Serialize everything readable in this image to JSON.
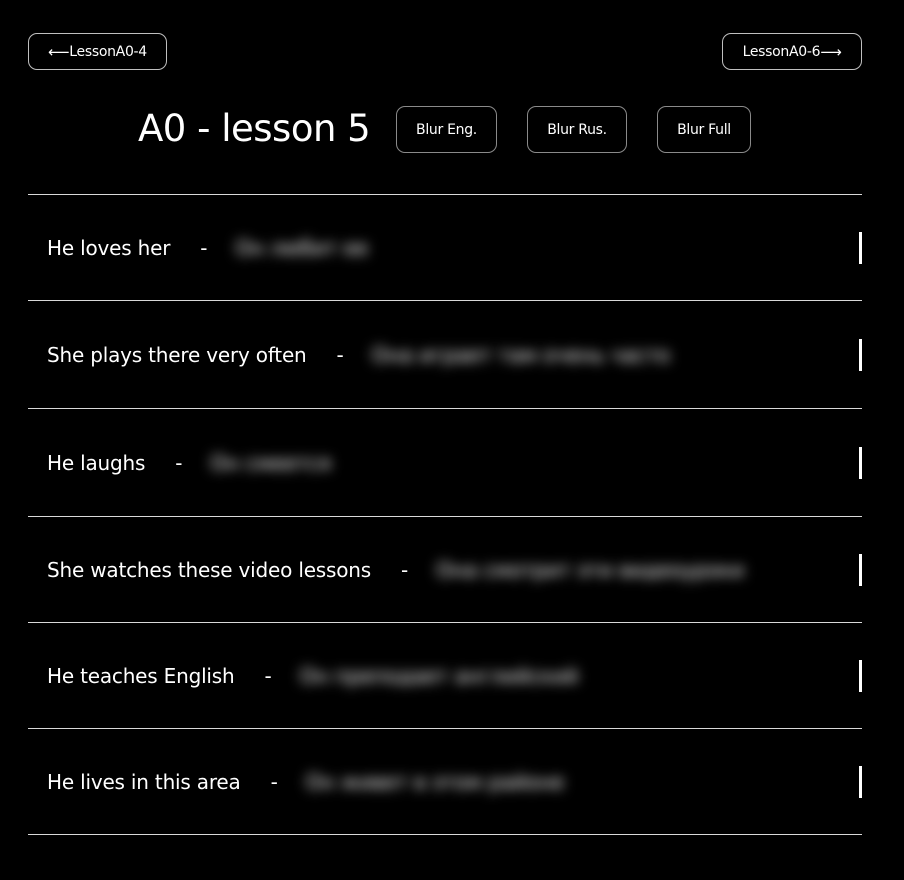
{
  "nav": {
    "prev_label": "LessonA0-4",
    "next_label": "LessonA0-6",
    "prev_arrow": "⟵",
    "next_arrow": "⟶"
  },
  "header": {
    "title": "A0 - lesson 5",
    "blur_eng_label": "Blur Eng.",
    "blur_rus_label": "Blur Rus.",
    "blur_full_label": "Blur Full"
  },
  "phrases": [
    {
      "english": "He loves her",
      "separator": "-",
      "russian": "Он любит ее"
    },
    {
      "english": "She plays there very often",
      "separator": "-",
      "russian": "Она играет там очень часто"
    },
    {
      "english": "He laughs",
      "separator": "-",
      "russian": "Он смеется"
    },
    {
      "english": "She watches these video lessons",
      "separator": "-",
      "russian": "Она смотрит эти видеоуроки"
    },
    {
      "english": "He teaches English",
      "separator": "-",
      "russian": "Он преподает английский"
    },
    {
      "english": "He lives in this area",
      "separator": "-",
      "russian": "Он живет в этом районе"
    }
  ]
}
